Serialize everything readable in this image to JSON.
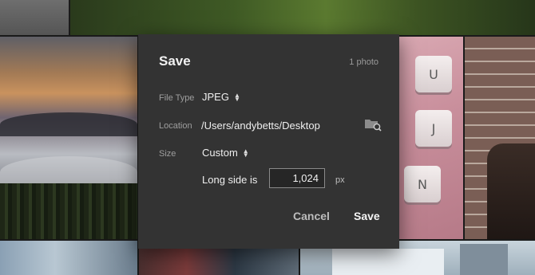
{
  "dialog": {
    "title": "Save",
    "photo_count": "1 photo",
    "file_type": {
      "label": "File Type",
      "value": "JPEG"
    },
    "location": {
      "label": "Location",
      "path": "/Users/andybetts/Desktop",
      "icon": "folder-search-icon"
    },
    "size": {
      "label": "Size",
      "value": "Custom"
    },
    "long_side": {
      "label": "Long side is",
      "value": "1,024",
      "unit": "px"
    },
    "buttons": {
      "cancel": "Cancel",
      "save": "Save"
    }
  },
  "background": {
    "keyboard_keys": [
      "U",
      "J",
      "N"
    ]
  },
  "colors": {
    "dialog_bg": "#333333",
    "input_bg": "#262626",
    "label_gray": "#9e9e9e",
    "text_light": "#efefef"
  }
}
